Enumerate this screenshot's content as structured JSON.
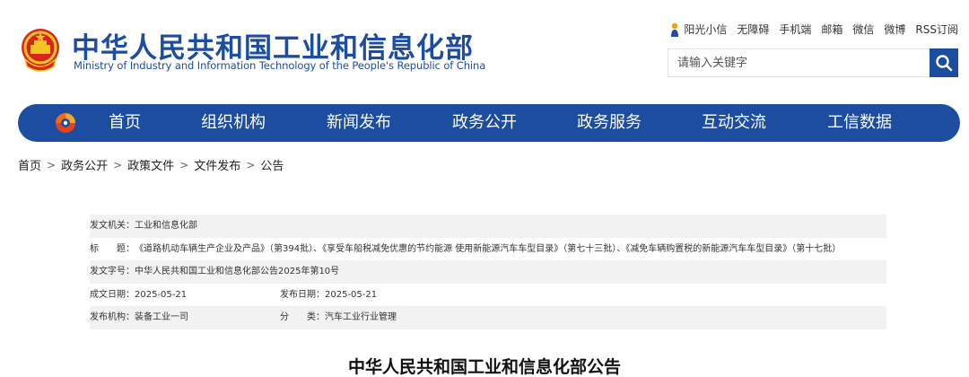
{
  "header": {
    "site_title": "中华人民共和国工业和信息化部",
    "site_subtitle": "Ministry of Industry and Information Technology of the People's Republic of China",
    "top_links": [
      "阳光小信",
      "无障碍",
      "手机端",
      "邮箱",
      "微信",
      "微博",
      "RSS订阅"
    ],
    "search": {
      "placeholder": "请输入关键字"
    }
  },
  "nav": {
    "items": [
      "首页",
      "组织机构",
      "新闻发布",
      "政务公开",
      "政务服务",
      "互动交流",
      "工信数据"
    ]
  },
  "breadcrumb": {
    "items": [
      "首页",
      "政务公开",
      "政策文件",
      "文件发布",
      "公告"
    ],
    "separator": ">"
  },
  "info": {
    "issuer_label": "发文机关：",
    "issuer": "工业和信息化部",
    "title_label": "标　　题：",
    "title": "《道路机动车辆生产企业及产品》（第394批）、《享受车船税减免优惠的节约能源 使用新能源汽车车型目录》（第七十三批）、《减免车辆购置税的新能源汽车车型目录》（第十七批）",
    "doc_no_label": "发文字号：",
    "doc_no": "中华人民共和国工业和信息化部公告2025年第10号",
    "written_date_label": "成文日期：",
    "written_date": "2025-05-21",
    "publish_date_label": "发布日期：",
    "publish_date": "2025-05-21",
    "org_label": "发布机构：",
    "org": "装备工业一司",
    "category_label": "分　　类：",
    "category": "汽车工业行业管理"
  },
  "doc": {
    "title": "中华人民共和国工业和信息化部公告"
  },
  "colors": {
    "brand_blue": "#1c4da1",
    "row_shade": "#f2f2f2"
  },
  "icons": {
    "emblem": "national-emblem-icon",
    "sun": "sun-person-icon",
    "search": "search-icon",
    "nav_logo": "miit-logo-icon"
  }
}
